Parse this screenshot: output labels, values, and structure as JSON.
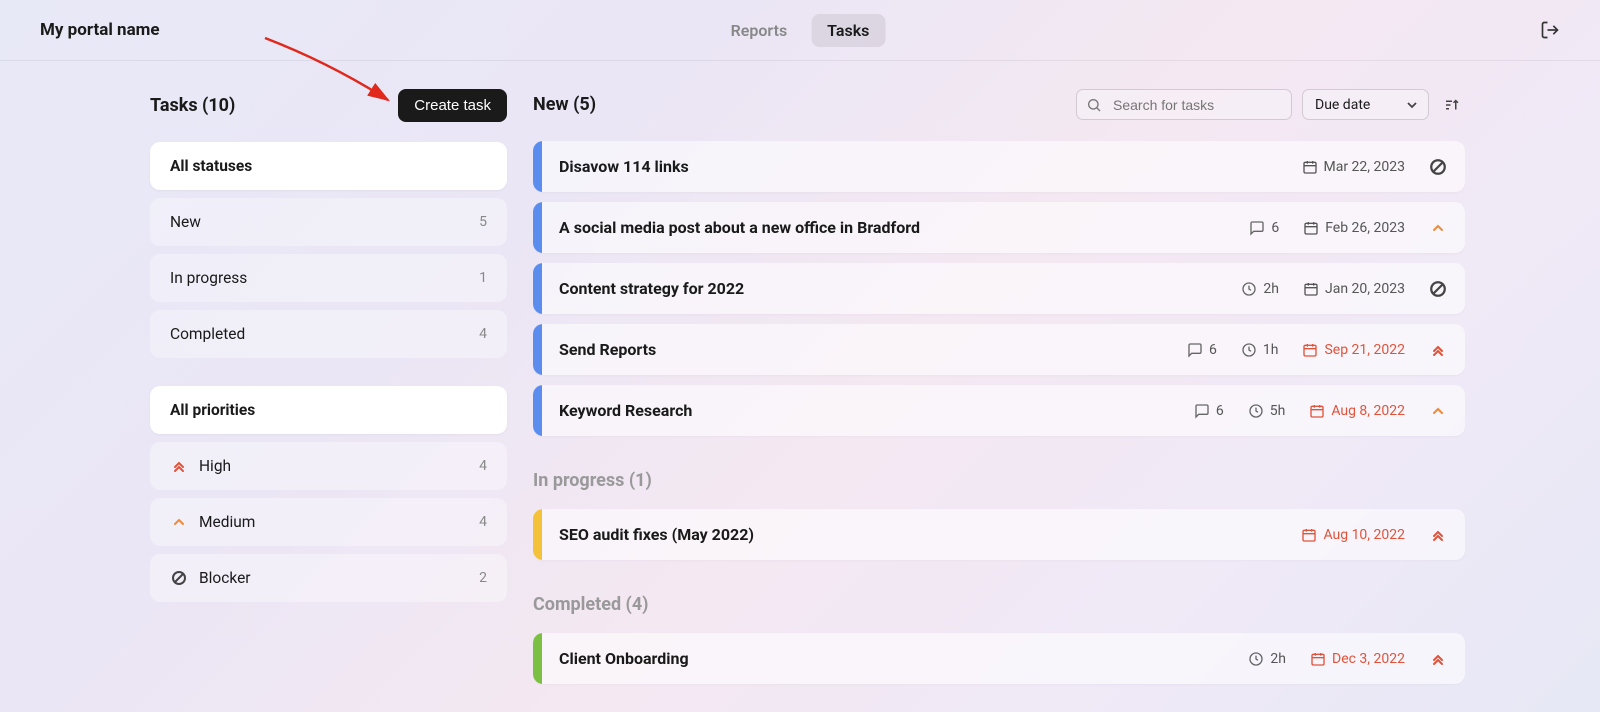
{
  "header": {
    "portal_title": "My portal name",
    "tabs": {
      "reports": "Reports",
      "tasks": "Tasks"
    }
  },
  "sidebar": {
    "title": "Tasks (10)",
    "create_label": "Create task",
    "statuses": {
      "all": "All statuses",
      "items": [
        {
          "label": "New",
          "count": "5"
        },
        {
          "label": "In progress",
          "count": "1"
        },
        {
          "label": "Completed",
          "count": "4"
        }
      ]
    },
    "priorities": {
      "all": "All priorities",
      "items": [
        {
          "label": "High",
          "count": "4"
        },
        {
          "label": "Medium",
          "count": "4"
        },
        {
          "label": "Blocker",
          "count": "2"
        }
      ]
    }
  },
  "toolbar": {
    "search_placeholder": "Search for tasks",
    "sort_label": "Due date"
  },
  "sections": {
    "new_title": "New (5)",
    "inprogress_title": "In progress (1)",
    "completed_title": "Completed (4)"
  },
  "tasks": {
    "new": [
      {
        "name": "Disavow 114 links",
        "comments": "",
        "time": "",
        "due": "Mar 22, 2023",
        "overdue": false,
        "priority": "blocker"
      },
      {
        "name": "A social media post about a new office in Bradford",
        "comments": "6",
        "time": "",
        "due": "Feb 26, 2023",
        "overdue": false,
        "priority": "medium"
      },
      {
        "name": "Content strategy for 2022",
        "comments": "",
        "time": "2h",
        "due": "Jan 20, 2023",
        "overdue": false,
        "priority": "blocker"
      },
      {
        "name": "Send Reports",
        "comments": "6",
        "time": "1h",
        "due": "Sep 21, 2022",
        "overdue": true,
        "priority": "high"
      },
      {
        "name": "Keyword Research",
        "comments": "6",
        "time": "5h",
        "due": "Aug 8, 2022",
        "overdue": true,
        "priority": "medium"
      }
    ],
    "inprogress": [
      {
        "name": "SEO audit fixes (May 2022)",
        "comments": "",
        "time": "",
        "due": "Aug 10, 2022",
        "overdue": true,
        "priority": "high"
      }
    ],
    "completed": [
      {
        "name": "Client Onboarding",
        "comments": "",
        "time": "2h",
        "due": "Dec 3, 2022",
        "overdue": true,
        "priority": "high"
      }
    ]
  }
}
